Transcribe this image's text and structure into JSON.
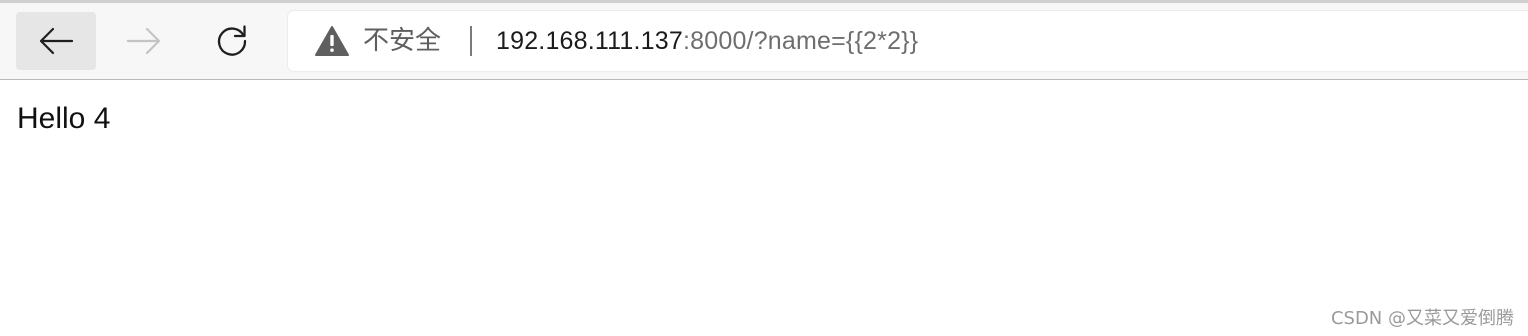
{
  "toolbar": {
    "back_icon": "arrow-left-icon",
    "forward_icon": "arrow-right-icon",
    "refresh_icon": "refresh-icon",
    "forward_enabled": false
  },
  "address_bar": {
    "security_icon": "warning-triangle-icon",
    "security_label": "不安全",
    "url_host": "192.168.111.137",
    "url_rest": ":8000/?name={{2*2}}"
  },
  "page": {
    "content_text": "Hello 4"
  },
  "watermark": {
    "text": "CSDN @又菜又爱倒腾"
  },
  "colors": {
    "toolbar_bg": "#f7f7f7",
    "active_button_bg": "#e6e6e6",
    "disabled_icon": "#c4c4c4",
    "url_host_color": "#1b1b1b",
    "url_rest_color": "#6e6e6e"
  }
}
